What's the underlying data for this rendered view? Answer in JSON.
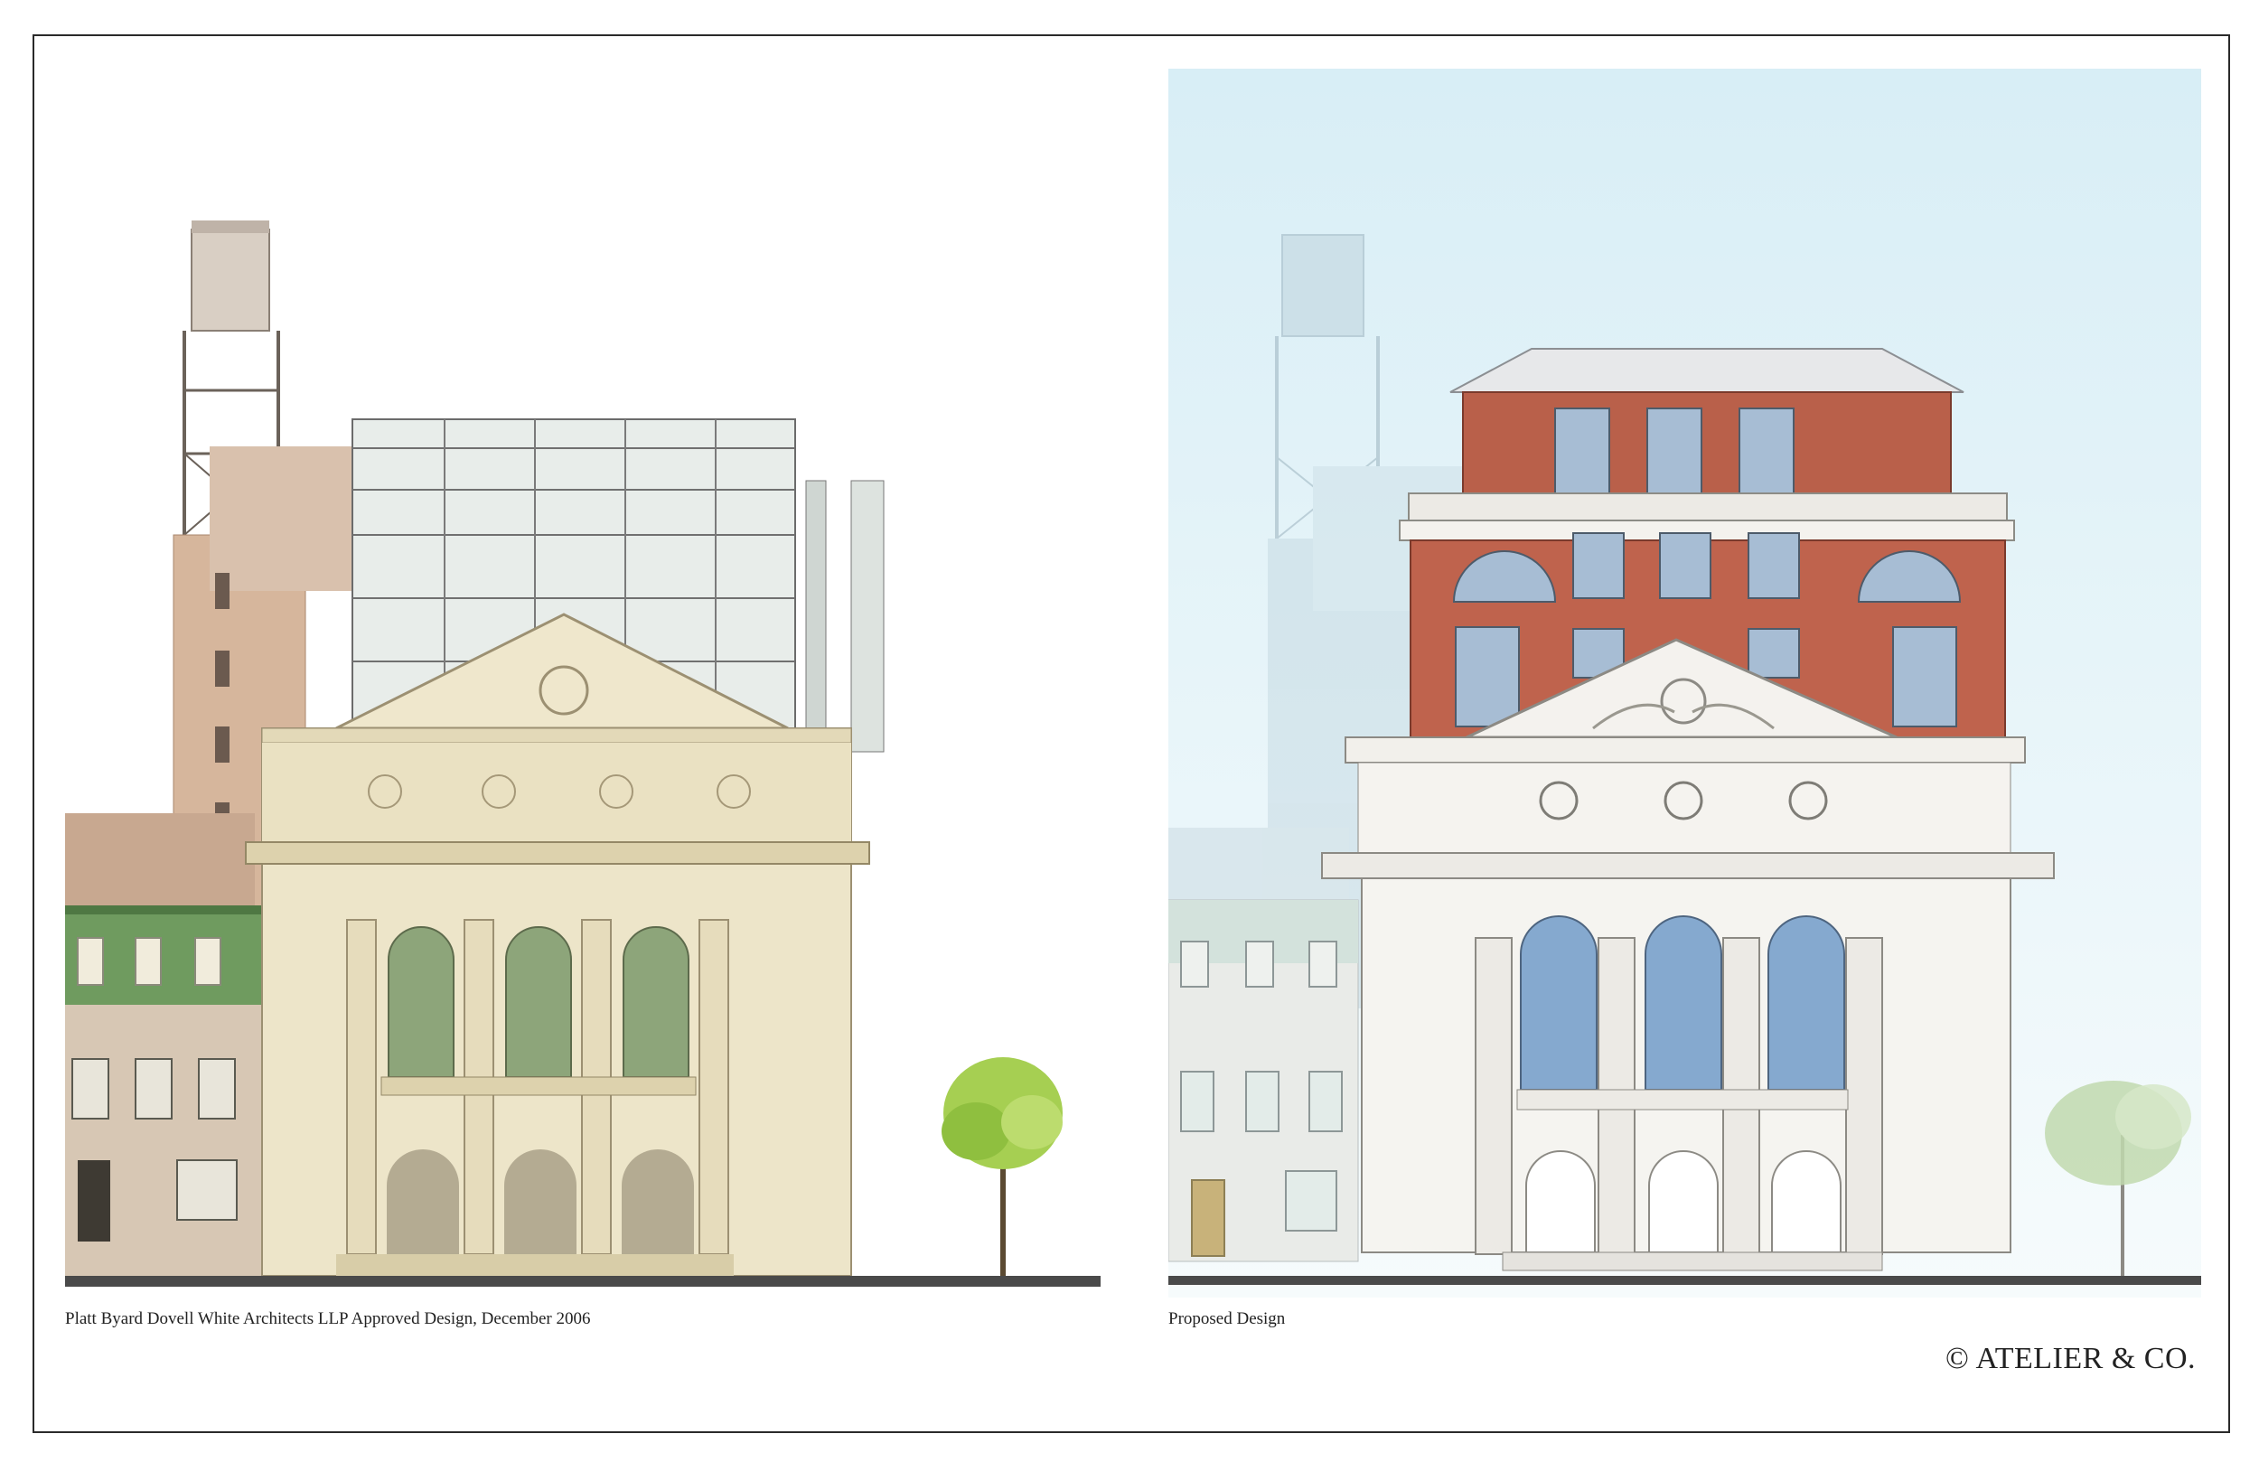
{
  "left_panel": {
    "caption": "Platt Byard Dovell White Architects LLP Approved Design, December 2006"
  },
  "right_panel": {
    "caption": "Proposed Design"
  },
  "footer": {
    "copyright": "© ATELIER & CO."
  },
  "colors": {
    "left_stone": "#ece4c8",
    "left_tower": "#cdb39a",
    "left_mansard": "#5e8c52",
    "right_sky": "#dbeef6",
    "right_brick": "#b85e47",
    "right_stone": "#f4f2ee",
    "right_glass": "#7fa6cc",
    "tree_left": "#9fc94a",
    "tree_right": "#b8d3a6"
  }
}
